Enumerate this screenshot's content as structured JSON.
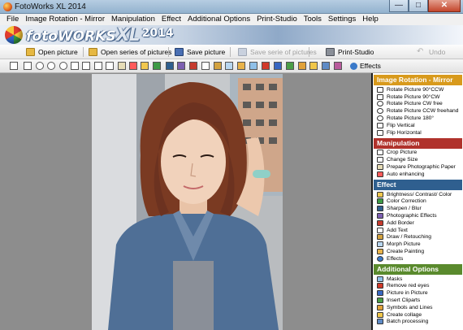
{
  "window": {
    "title": "FotoWorks XL 2014",
    "controls": [
      "—",
      "□",
      "✕"
    ]
  },
  "menu": [
    "File",
    "Image Rotation - Mirror",
    "Manipulation",
    "Effect",
    "Additional Options",
    "Print-Studio",
    "Tools",
    "Settings",
    "Help"
  ],
  "brand": {
    "foto": "foto",
    "works": "WORKS",
    "xl": "XL",
    "year": "2014"
  },
  "toolbar": {
    "open_picture": "Open picture",
    "open_series": "Open series of pictures",
    "save_picture": "Save picture",
    "save_series": "Save serie of pictures",
    "print_studio": "Print-Studio",
    "undo": "Undo"
  },
  "tools_effects_label": "Effects",
  "sidebar": {
    "rotation": {
      "title": "Image Rotation - Mirror",
      "items": [
        "Rotate Picture 90°CCW",
        "Rotate Picture 90°CW",
        "Rotate Picture CW free",
        "Rotate Picture CCW freehand",
        "Rotate Picture 180°",
        "Flip Vertical",
        "Flip Horizontal"
      ]
    },
    "manipulation": {
      "title": "Manipulation",
      "items": [
        "Crop Picture",
        "Change Size",
        "Prepare Photographic Paper",
        "Auto enhancing"
      ]
    },
    "effect": {
      "title": "Effect",
      "items": [
        "Brightness/ Contrast/ Color",
        "Color Correction",
        "Sharpen / Blur",
        "Photographic Effects",
        "Add Border",
        "Add Text",
        "Draw / Retouching",
        "Morph Picture",
        "Create Painting",
        "Effects"
      ]
    },
    "additional": {
      "title": "Additional Options",
      "items": [
        "Masks",
        "Remove red eyes",
        "Picture in Picture",
        "Insert Cliparts",
        "Symbols and Lines",
        "Create collage",
        "Batch processing"
      ]
    }
  },
  "colors": {
    "rotation": "#d89a1c",
    "manipulation": "#b0322c",
    "effect": "#2f5f8f",
    "additional": "#5a8a2d"
  }
}
